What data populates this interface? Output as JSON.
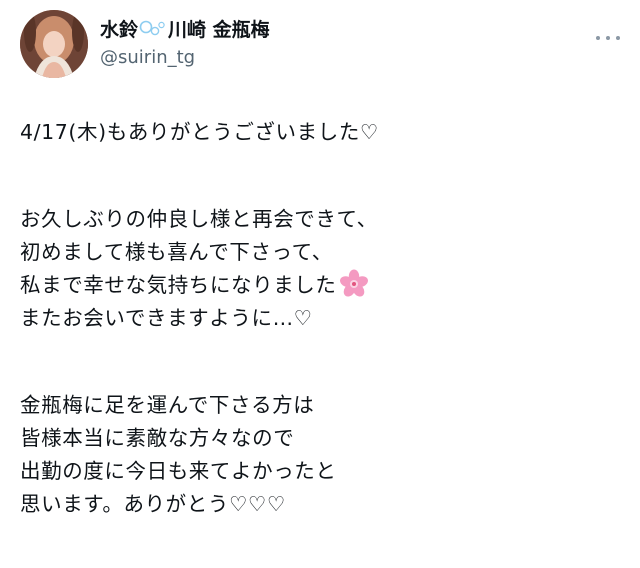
{
  "user": {
    "display_name_part1": "水鈴",
    "display_name_part2": "川崎 金瓶梅",
    "handle": "@suirin_tg",
    "name_icon": "bubbles-icon"
  },
  "tweet": {
    "line1": "4/17(木)もありがとうございました♡",
    "line2": "お久しぶりの仲良し様と再会できて、",
    "line3": "初めまして様も喜んで下さって、",
    "line4": "私まで幸せな気持ちになりました",
    "line4_emoji": "cherry-blossom-icon",
    "line5": "またお会いできますように…♡",
    "line6": "金瓶梅に足を運んで下さる方は",
    "line7": "皆様本当に素敵な方々なので",
    "line8": "出勤の度に今日も来てよかったと",
    "line9": "思います。ありがとう♡♡♡"
  },
  "more_menu_icon": "more-options-icon",
  "colors": {
    "text": "#0f1419",
    "handle": "#536471",
    "more": "#8b98a5",
    "bubble": "#8ecdf0",
    "flower": "#f49ac1"
  }
}
